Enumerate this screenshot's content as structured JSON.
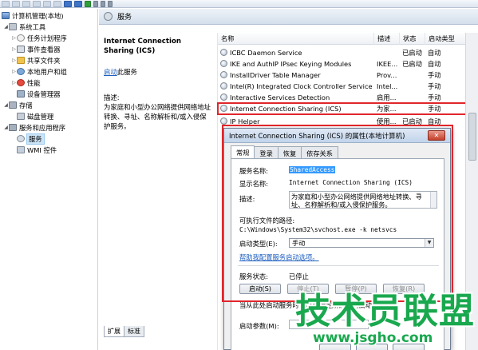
{
  "header": {
    "title": "服务"
  },
  "tree": {
    "items": [
      {
        "label": "计算机管理(本地)",
        "icon": "computer-icon"
      },
      {
        "label": "系统工具",
        "icon": "tools-icon"
      },
      {
        "label": "任务计划程序",
        "icon": "clock-icon"
      },
      {
        "label": "事件查看器",
        "icon": "event-icon"
      },
      {
        "label": "共享文件夹",
        "icon": "folder-icon"
      },
      {
        "label": "本地用户和组",
        "icon": "users-icon"
      },
      {
        "label": "性能",
        "icon": "perf-icon"
      },
      {
        "label": "设备管理器",
        "icon": "device-icon"
      },
      {
        "label": "存储",
        "icon": "storage-icon"
      },
      {
        "label": "磁盘管理",
        "icon": "disk-icon"
      },
      {
        "label": "服务和应用程序",
        "icon": "apps-icon"
      },
      {
        "label": "服务",
        "icon": "gear-icon"
      },
      {
        "label": "WMI 控件",
        "icon": "wmi-icon"
      }
    ]
  },
  "detail": {
    "name": "Internet Connection Sharing (ICS)",
    "start_link": "启动",
    "start_suffix": "此服务",
    "desc_label": "描述:",
    "desc_text": "为家庭和小型办公网络提供网络地址转换、寻址、名称解析和/或入侵保护服务。"
  },
  "list": {
    "columns": [
      "名称",
      "描述",
      "状态",
      "启动类型"
    ],
    "rows": [
      {
        "name": "ICBC Daemon Service",
        "desc": "",
        "status": "已启动",
        "startup": "自动"
      },
      {
        "name": "IKE and AuthIP IPsec Keying Modules",
        "desc": "IKEE...",
        "status": "已启动",
        "startup": "自动"
      },
      {
        "name": "InstallDriver Table Manager",
        "desc": "Prov...",
        "status": "",
        "startup": "手动"
      },
      {
        "name": "Intel(R) Integrated Clock Controller Service ...",
        "desc": "Intel...",
        "status": "",
        "startup": "手动"
      },
      {
        "name": "Interactive Services Detection",
        "desc": "启用...",
        "status": "",
        "startup": "手动"
      },
      {
        "name": "Internet Connection Sharing (ICS)",
        "desc": "为家...",
        "status": "",
        "startup": "手动"
      },
      {
        "name": "IP Helper",
        "desc": "使用...",
        "status": "已启动",
        "startup": "自动"
      }
    ]
  },
  "bottom_tabs": [
    "扩展",
    "标准"
  ],
  "dialog": {
    "title": "Internet Connection Sharing (ICS) 的属性(本地计算机)",
    "close": "✕",
    "tabs": [
      "常规",
      "登录",
      "恢复",
      "依存关系"
    ],
    "service_name_label": "服务名称:",
    "service_name": "SharedAccess",
    "display_name_label": "显示名称:",
    "display_name": "Internet Connection Sharing (ICS)",
    "desc_label": "描述:",
    "desc_text": "为家庭和小型办公网络提供网络地址转换、寻址、名称解析和/或入侵保护服务。",
    "path_label": "可执行文件的路径:",
    "path": "C:\\Windows\\System32\\svchost.exe -k netsvcs",
    "startup_label": "启动类型(E):",
    "startup_value": "手动",
    "help_link": "帮助我配置服务启动选项。",
    "status_label": "服务状态:",
    "status_value": "已停止",
    "btn_start": "启动(S)",
    "btn_stop": "停止(T)",
    "btn_pause": "暂停(P)",
    "btn_resume": "恢复(R)",
    "hint": "当从此处启动服务时，您可指定所适用的启动参数。",
    "params_label": "启动参数(M):"
  },
  "watermark": {
    "cn": "技术员联盟",
    "url": "www.jsgho.com"
  },
  "colors": {
    "highlight": "#e0262b",
    "link": "#1e5fbf",
    "watermark": "#19a84e"
  }
}
